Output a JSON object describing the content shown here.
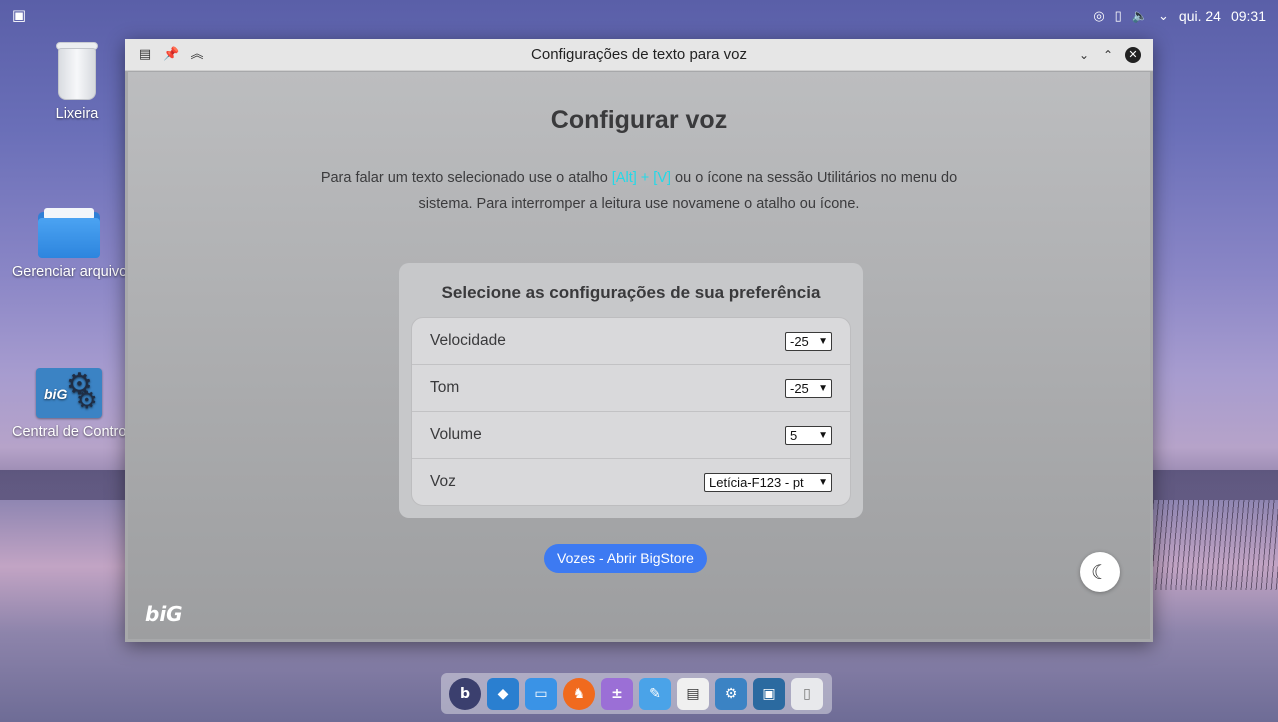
{
  "panel": {
    "menu_icon": "app-menu-icon",
    "tray_icons": [
      "check-circle-icon",
      "clipboard-icon",
      "volume-icon",
      "chevron-down-icon"
    ],
    "date": "qui. 24",
    "time": "09:31"
  },
  "desktop": {
    "icons": [
      {
        "label": "Lixeira",
        "icon": "trash-icon"
      },
      {
        "label": "Gerenciar arquivos",
        "icon": "folder-icon"
      },
      {
        "label": "Central de Controle",
        "icon": "control-center-icon"
      }
    ]
  },
  "window": {
    "title": "Configurações de texto para voz",
    "heading": "Configurar voz",
    "desc_before": "Para falar um texto selecionado use o atalho ",
    "shortcut": "[Alt] + [V]",
    "desc_after": " ou o ícone na sessão Utilitários no menu do sistema. Para interromper a leitura use novamene o atalho ou ícone.",
    "card_title": "Selecione as configurações de sua preferência",
    "settings": [
      {
        "label": "Velocidade",
        "value": "-25"
      },
      {
        "label": "Tom",
        "value": "-25"
      },
      {
        "label": "Volume",
        "value": "5"
      },
      {
        "label": "Voz",
        "value": "Letícia-F123 - pt"
      }
    ],
    "store_button": "Vozes - Abrir BigStore",
    "logo": "biG",
    "accent_color": "#3d7af2",
    "shortcut_color": "#23d9e8"
  },
  "dock": {
    "items": [
      "big-menu-icon",
      "workspaces-icon",
      "file-manager-icon",
      "brave-browser-icon",
      "calculator-icon",
      "text-editor-icon",
      "text-to-speech-icon",
      "control-center-icon",
      "remote-desktop-icon",
      "trash-icon"
    ]
  }
}
